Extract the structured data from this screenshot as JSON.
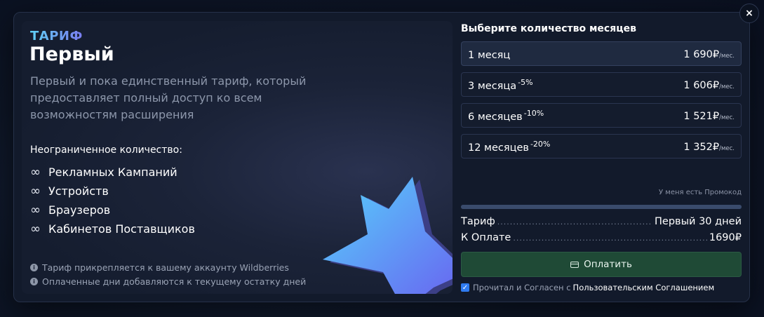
{
  "close_label": "×",
  "plan": {
    "tag": "ТАРИФ",
    "name": "Первый",
    "description": "Первый и пока единственный тариф, который предоставляет полный доступ ко всем возможностям расширения",
    "unlimited_title": "Неограниченное количество:",
    "infinity_glyph": "∞",
    "features": [
      "Рекламных Кампаний",
      "Устройств",
      "Браузеров",
      "Кабинетов Поставщиков"
    ],
    "notes": [
      "Тариф прикрепляется к вашему аккаунту Wildberries",
      "Оплаченные дни добавляются к текущему остатку дней"
    ],
    "note_icon": "i"
  },
  "months": {
    "title": "Выберите количество месяцев",
    "per_month": "/мес.",
    "options": [
      {
        "label": "1 месяц",
        "discount": "",
        "price": "1 690₽",
        "selected": true
      },
      {
        "label": "3 месяца",
        "discount": "-5%",
        "price": "1 606₽",
        "selected": false
      },
      {
        "label": "6 месяцев",
        "discount": "-10%",
        "price": "1 521₽",
        "selected": false
      },
      {
        "label": "12 месяцев",
        "discount": "-20%",
        "price": "1 352₽",
        "selected": false
      }
    ]
  },
  "promo_link": "У меня есть Промокод",
  "summary": {
    "tariff_label": "Тариф",
    "tariff_value": "Первый 30 дней",
    "pay_label": "К Оплате",
    "pay_value": "1690₽",
    "dots": "................................................................................................................................"
  },
  "pay_button": "Оплатить",
  "agreement": {
    "checked": true,
    "check_glyph": "✓",
    "text": "Прочитал и Согласен с",
    "link": "Пользовательским Соглашением"
  },
  "colors": {
    "accent_green": "#1f4a36",
    "checkbox_blue": "#2f7bf0",
    "tag_gradient_start": "#5fd0f5",
    "tag_gradient_end": "#7a7cf0",
    "star_start": "#56d3fb",
    "star_end": "#6a5cf0"
  },
  "icons": [
    "close-icon",
    "infinity-icon",
    "info-icon",
    "credit-card-icon",
    "checkbox-icon",
    "star-illustration"
  ]
}
